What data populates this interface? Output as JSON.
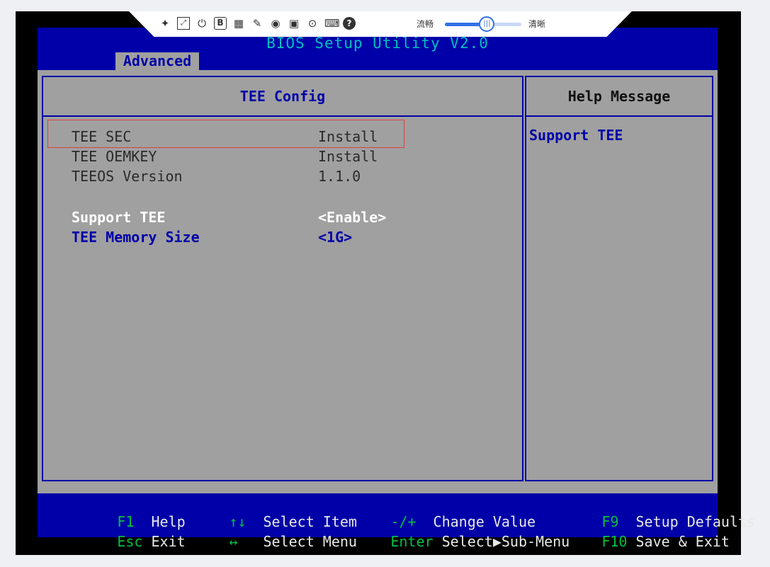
{
  "toolbar": {
    "icons": [
      "pin-icon",
      "fullscreen-icon",
      "power-icon",
      "boot-icon",
      "network-icon",
      "mouse-icon",
      "disc-icon",
      "save-icon",
      "record-icon",
      "keyboard-icon",
      "help-icon"
    ],
    "label_smooth": "流畅",
    "label_clear": "清晰",
    "quality_level": 0.55
  },
  "bios": {
    "title": "BIOS Setup Utility V2.0",
    "active_tab": "Advanced",
    "main_header": "TEE Config",
    "help_header": "Help Message",
    "help_text": "Support TEE",
    "rows": [
      {
        "label": "TEE SEC",
        "value": "Install"
      },
      {
        "label": "TEE OEMKEY",
        "value": "Install"
      },
      {
        "label": "TEEOS Version",
        "value": "1.1.0"
      },
      {
        "label": "Support TEE",
        "value": "<Enable>"
      },
      {
        "label": "TEE Memory Size",
        "value": "<1G>"
      }
    ],
    "footer": {
      "f1_key": "F1",
      "f1_desc": "Help",
      "updown_key": "↑↓",
      "updown_desc": "Select Item",
      "plusminus_key": "-/+",
      "plusminus_desc": "Change Value",
      "f9_key": "F9",
      "f9_desc": "Setup Defaults",
      "esc_key": "Esc",
      "esc_desc": "Exit",
      "leftright_key": "↔",
      "leftright_desc": "Select Menu",
      "enter_key": "Enter",
      "enter_desc": "Select▶Sub-Menu",
      "f10_key": "F10",
      "f10_desc": "Save & Exit"
    }
  },
  "colors": {
    "bios_blue": "#0000a8",
    "bios_gray": "#a0a0a0",
    "key_green": "#00c040",
    "highlight_red": "#e04040",
    "slider_blue": "#3470e8"
  }
}
